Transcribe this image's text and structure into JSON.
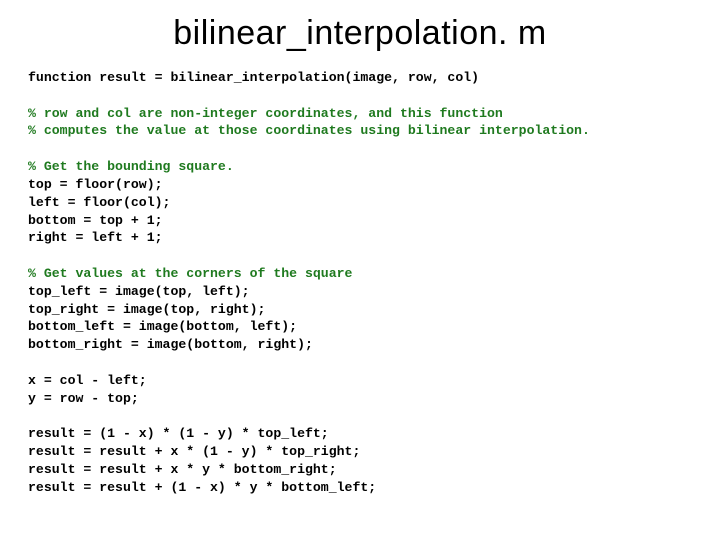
{
  "title": "bilinear_interpolation. m",
  "code": {
    "l01": "function result = bilinear_interpolation(image, row, col)",
    "c01": "% row and col are non-integer coordinates, and this function",
    "c02": "% computes the value at those coordinates using bilinear interpolation.",
    "c03": "% Get the bounding square.",
    "l02": "top = floor(row);",
    "l03": "left = floor(col);",
    "l04": "bottom = top + 1;",
    "l05": "right = left + 1;",
    "c04": "% Get values at the corners of the square",
    "l06": "top_left = image(top, left);",
    "l07": "top_right = image(top, right);",
    "l08": "bottom_left = image(bottom, left);",
    "l09": "bottom_right = image(bottom, right);",
    "l10": "x = col - left;",
    "l11": "y = row - top;",
    "l12": "result = (1 - x) * (1 - y) * top_left;",
    "l13": "result = result + x * (1 - y) * top_right;",
    "l14": "result = result + x * y * bottom_right;",
    "l15": "result = result + (1 - x) * y * bottom_left;"
  }
}
